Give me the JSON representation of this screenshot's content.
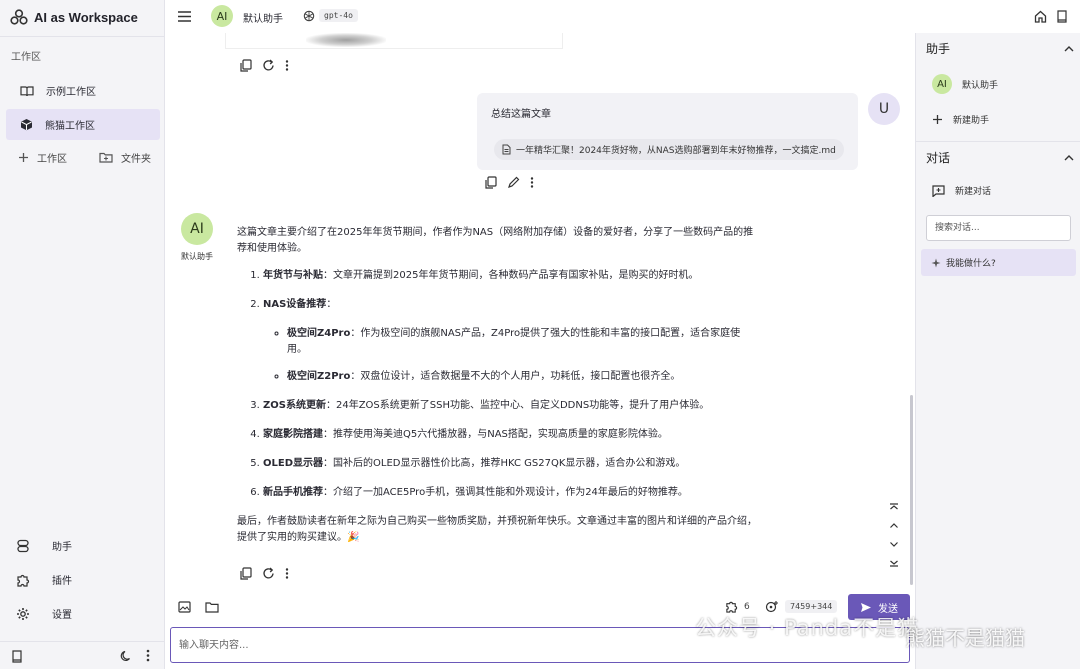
{
  "app": {
    "title": "AI as Workspace"
  },
  "sidebar": {
    "section_label": "工作区",
    "workspaces": [
      {
        "label": "示例工作区",
        "icon": "book-open-icon",
        "active": false
      },
      {
        "label": "熊猫工作区",
        "icon": "cube-icon",
        "active": true
      }
    ],
    "actions": {
      "add_workspace": "工作区",
      "add_folder": "文件夹"
    },
    "nav": [
      {
        "label": "助手",
        "icon": "assistant-icon"
      },
      {
        "label": "插件",
        "icon": "puzzle-icon"
      },
      {
        "label": "设置",
        "icon": "gear-icon"
      }
    ]
  },
  "header": {
    "assistant_avatar": "AI",
    "assistant_name": "默认助手",
    "model": "gpt-4o"
  },
  "chat": {
    "user_avatar": "U",
    "user_message": "总结这篇文章",
    "attachment": "一年精华汇聚！2024年货好物，从NAS选购部署到年末好物推荐，一文搞定.md",
    "assistant_avatar": "AI",
    "assistant_label": "默认助手",
    "answer": {
      "intro": "这篇文章主要介绍了在2025年年货节期间，作者作为NAS（网络附加存储）设备的爱好者，分享了一些数码产品的推荐和使用体验。",
      "items": [
        {
          "title": "年货节与补贴",
          "text": "：文章开篇提到2025年年货节期间，各种数码产品享有国家补贴，是购买的好时机。"
        },
        {
          "title": "NAS设备推荐",
          "text": "："
        },
        {
          "title": "ZOS系统更新",
          "text": "：24年ZOS系统更新了SSH功能、监控中心、自定义DDNS功能等，提升了用户体验。"
        },
        {
          "title": "家庭影院搭建",
          "text": "：推荐使用海美迪Q5六代播放器，与NAS搭配，实现高质量的家庭影院体验。"
        },
        {
          "title": "OLED显示器",
          "text": "：国补后的OLED显示器性价比高，推荐HKC GS27QK显示器，适合办公和游戏。"
        },
        {
          "title": "新品手机推荐",
          "text": "：介绍了一加ACE5Pro手机，强调其性能和外观设计，作为24年最后的好物推荐。"
        }
      ],
      "subitems": [
        {
          "title": "极空间Z4Pro",
          "text": "：作为极空间的旗舰NAS产品，Z4Pro提供了强大的性能和丰富的接口配置，适合家庭使用。"
        },
        {
          "title": "极空间Z2Pro",
          "text": "：双盘位设计，适合数据量不大的个人用户，功耗低，接口配置也很齐全。"
        }
      ],
      "outro": "最后，作者鼓励读者在新年之际为自己购买一些物质奖励，并预祝新年快乐。文章通过丰富的图片和详细的产品介绍，提供了实用的购买建议。🎉"
    }
  },
  "input": {
    "placeholder": "输入聊天内容...",
    "plugin_count": "6",
    "tokens": "7459+344",
    "send_label": "发送"
  },
  "right_panel": {
    "assistants_title": "助手",
    "assistants": [
      {
        "avatar": "AI",
        "label": "默认助手"
      }
    ],
    "new_assistant": "新建助手",
    "conversations_title": "对话",
    "new_conversation": "新建对话",
    "search_placeholder": "搜索对话...",
    "conversations": [
      {
        "label": "我能做什么?",
        "icon": "sparkle-icon"
      }
    ]
  },
  "watermark": {
    "text": "公众号 · Panda不是猫",
    "text2": "熊猫不是猫猫"
  },
  "colors": {
    "accent": "#6a58b8",
    "active_bg": "#e6e2f5",
    "avatar_ai": "#c9e8a0",
    "avatar_user": "#e6e2f5"
  }
}
